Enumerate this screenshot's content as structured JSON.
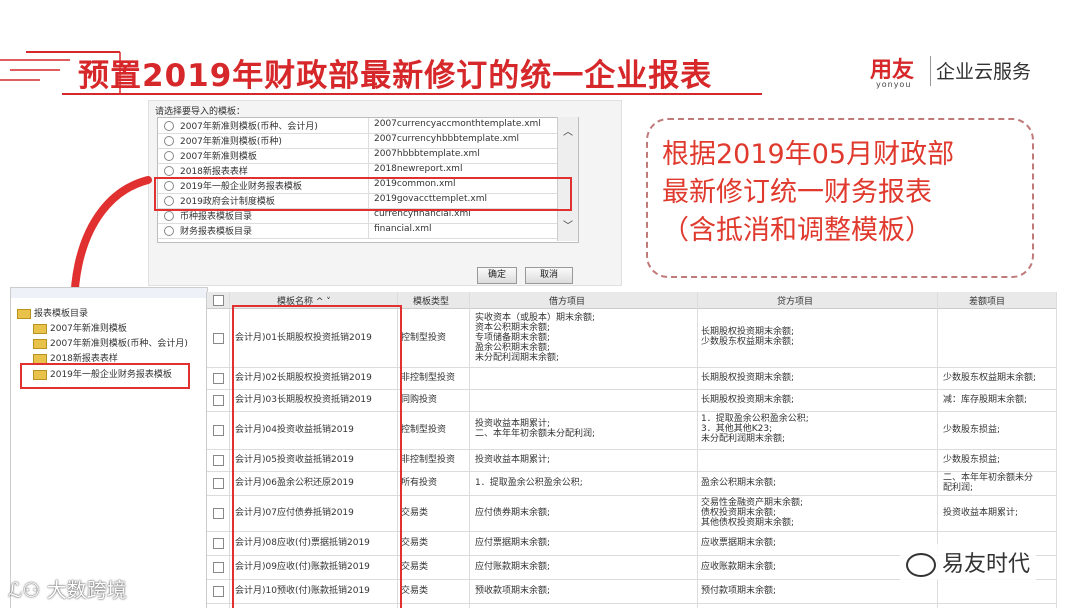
{
  "slide": {
    "title": "预置2019年财政部最新修订的统一企业报表",
    "brand": {
      "logo": "用友",
      "logo_sub": "yonyou",
      "text": "企业云服务"
    }
  },
  "dialog": {
    "label": "请选择要导入的模板：",
    "rows": [
      {
        "name": "2007年新准则模板(币种、会计月)",
        "file": "2007currencyaccmonthtemplate.xml"
      },
      {
        "name": "2007年新准则模板(币种)",
        "file": "2007currencyhbbbtemplate.xml"
      },
      {
        "name": "2007年新准则模板",
        "file": "2007hbbbtemplate.xml"
      },
      {
        "name": "2018新报表表样",
        "file": "2018newreport.xml"
      },
      {
        "name": "2019年一般企业财务报表模板",
        "file": "2019common.xml"
      },
      {
        "name": "2019政府会计制度模板",
        "file": "2019govaccttemplet.xml"
      },
      {
        "name": "币种报表模板目录",
        "file": "currencyfinancial.xml"
      },
      {
        "name": "财务报表模板目录",
        "file": "financial.xml"
      }
    ],
    "ok_label": "确定",
    "cancel_label": "取消"
  },
  "annotation": {
    "line1": "根据2019年05月财政部",
    "line2": "最新修订统一财务报表",
    "line3": "（含抵消和调整模板）"
  },
  "tree": {
    "root": "报表模板目录",
    "items": [
      "2007年新准则模板",
      "2007年新准则模板(币种、会计月)",
      "2018新报表表样",
      "2019年一般企业财务报表模板"
    ]
  },
  "table": {
    "headers": [
      "模板名称 ^ ˅",
      "模板类型",
      "借方项目",
      "贷方项目",
      "差额项目"
    ],
    "rows": [
      {
        "name": "会计月)01长期股权投资抵销2019",
        "type": "控制型投资",
        "debit": "实收资本（或股本）期末余额;\n资本公积期末余额;\n专项储备期末余额;\n盈余公积期末余额;\n未分配利润期末余额;",
        "credit": "长期股权投资期末余额;\n少数股东权益期末余额;",
        "diff": ""
      },
      {
        "name": "会计月)02长期股权投资抵销2019",
        "type": "非控制型投资",
        "debit": "",
        "credit": "长期股权投资期末余额;",
        "diff": "少数股东权益期末余额;"
      },
      {
        "name": "会计月)03长期股权投资抵销2019",
        "type": "同购投资",
        "debit": "",
        "credit": "长期股权投资期末余额;",
        "diff": "减：库存股期末余额;"
      },
      {
        "name": "会计月)04投资收益抵销2019",
        "type": "控制型投资",
        "debit": "投资收益本期累计;\n二、本年年初余额未分配利润;",
        "credit": "1．提取盈余公积盈余公积;\n3．其他其他K23;\n未分配利润期末余额;",
        "diff": "少数股东损益;"
      },
      {
        "name": "会计月)05投资收益抵销2019",
        "type": "非控制型投资",
        "debit": "投资收益本期累计;",
        "credit": "",
        "diff": "少数股东损益;"
      },
      {
        "name": "会计月)06盈余公积还原2019",
        "type": "所有投资",
        "debit": "1．提取盈余公积盈余公积;",
        "credit": "盈余公积期末余额;",
        "diff": "二、本年年初余额未分\n配利润;"
      },
      {
        "name": "会计月)07应付债券抵销2019",
        "type": "交易类",
        "debit": "应付债券期末余额;",
        "credit": "交易性金融资产期末余额;\n债权投资期末余额;\n其他债权投资期末余额;",
        "diff": "投资收益本期累计;"
      },
      {
        "name": "会计月)08应收(付)票据抵销2019",
        "type": "交易类",
        "debit": "应付票据期末余额;",
        "credit": "应收票据期末余额;",
        "diff": ""
      },
      {
        "name": "会计月)09应收(付)账款抵销2019",
        "type": "交易类",
        "debit": "应付账款期末余额;",
        "credit": "应收账款期末余额;",
        "diff": ""
      },
      {
        "name": "会计月)10预收(付)账款抵销2019",
        "type": "交易类",
        "debit": "预收款项期末余额;",
        "credit": "预付款项期末余额;",
        "diff": ""
      }
    ]
  },
  "watermarks": {
    "left": "大数跨境",
    "right": "易友时代"
  },
  "colors": {
    "accent": "#d6282a",
    "highlight": "#e0302f",
    "annotation_text": "#e03a2e"
  }
}
